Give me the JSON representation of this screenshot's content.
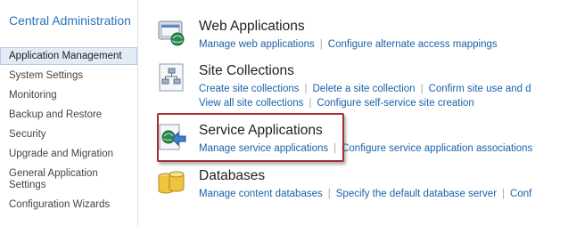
{
  "nav": {
    "title": "Central Administration",
    "items": [
      {
        "label": "Application Management",
        "selected": true
      },
      {
        "label": "System Settings"
      },
      {
        "label": "Monitoring"
      },
      {
        "label": "Backup and Restore"
      },
      {
        "label": "Security"
      },
      {
        "label": "Upgrade and Migration"
      },
      {
        "label": "General Application Settings"
      },
      {
        "label": "Configuration Wizards"
      }
    ]
  },
  "sections": [
    {
      "title": "Web Applications",
      "icon": "web-applications-icon",
      "links": [
        "Manage web applications",
        "Configure alternate access mappings"
      ]
    },
    {
      "title": "Site Collections",
      "icon": "site-collections-icon",
      "links": [
        "Create site collections",
        "Delete a site collection",
        "Confirm site use and d"
      ],
      "links2": [
        "View all site collections",
        "Configure self-service site creation"
      ]
    },
    {
      "title": "Service Applications",
      "icon": "service-applications-icon",
      "links": [
        "Manage service applications",
        "Configure service application associations"
      ]
    },
    {
      "title": "Databases",
      "icon": "databases-icon",
      "links": [
        "Manage content databases",
        "Specify the default database server",
        "Conf"
      ]
    }
  ],
  "colors": {
    "link": "#1a62aa",
    "highlight": "#a13034",
    "nav_title": "#2a73b9"
  }
}
